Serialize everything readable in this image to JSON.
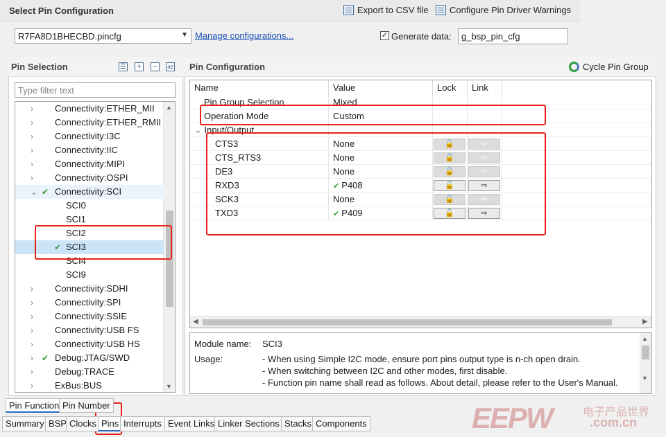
{
  "header": {
    "title": "Select Pin Configuration",
    "export_label": "Export to CSV file",
    "warnings_label": "Configure Pin Driver Warnings"
  },
  "config": {
    "selected_file": "R7FA8D1BHECBD.pincfg",
    "manage_link": "Manage configurations...",
    "generate_label": "Generate data:",
    "generate_checked": true,
    "generate_value": "g_bsp_pin_cfg"
  },
  "pin_selection": {
    "title": "Pin Selection",
    "filter_placeholder": "Type filter text",
    "items": [
      {
        "label": "Connectivity:ETHER_MII",
        "level": 0,
        "expanded": false,
        "check": false
      },
      {
        "label": "Connectivity:ETHER_RMII",
        "level": 0,
        "expanded": false,
        "check": false
      },
      {
        "label": "Connectivity:I3C",
        "level": 0,
        "expanded": false,
        "check": false
      },
      {
        "label": "Connectivity:IIC",
        "level": 0,
        "expanded": false,
        "check": false
      },
      {
        "label": "Connectivity:MIPI",
        "level": 0,
        "expanded": false,
        "check": false
      },
      {
        "label": "Connectivity:OSPI",
        "level": 0,
        "expanded": false,
        "check": false
      },
      {
        "label": "Connectivity:SCI",
        "level": 0,
        "expanded": true,
        "check": true
      },
      {
        "label": "SCI0",
        "level": 1,
        "check": false
      },
      {
        "label": "SCI1",
        "level": 1,
        "check": false
      },
      {
        "label": "SCI2",
        "level": 1,
        "check": false
      },
      {
        "label": "SCI3",
        "level": 1,
        "check": true,
        "selected": true
      },
      {
        "label": "SCI4",
        "level": 1,
        "check": false
      },
      {
        "label": "SCI9",
        "level": 1,
        "check": false
      },
      {
        "label": "Connectivity:SDHI",
        "level": 0,
        "expanded": false,
        "check": false
      },
      {
        "label": "Connectivity:SPI",
        "level": 0,
        "expanded": false,
        "check": false
      },
      {
        "label": "Connectivity:SSIE",
        "level": 0,
        "expanded": false,
        "check": false
      },
      {
        "label": "Connectivity:USB FS",
        "level": 0,
        "expanded": false,
        "check": false
      },
      {
        "label": "Connectivity:USB HS",
        "level": 0,
        "expanded": false,
        "check": false
      },
      {
        "label": "Debug:JTAG/SWD",
        "level": 0,
        "expanded": false,
        "check": true
      },
      {
        "label": "Debug:TRACE",
        "level": 0,
        "expanded": false,
        "check": false
      },
      {
        "label": "ExBus:BUS",
        "level": 0,
        "expanded": false,
        "check": false
      }
    ]
  },
  "pin_config": {
    "title": "Pin Configuration",
    "cycle_label": "Cycle Pin Group",
    "columns": [
      "Name",
      "Value",
      "Lock",
      "Link"
    ],
    "rows": [
      {
        "name": "Pin Group Selection",
        "value": "Mixed",
        "indent": 1,
        "buttons": false
      },
      {
        "name": "Operation Mode",
        "value": "Custom",
        "indent": 1,
        "buttons": false
      },
      {
        "name": "Input/Output",
        "value": "",
        "indent": 0,
        "group": true,
        "buttons": false
      },
      {
        "name": "CTS3",
        "value": "None",
        "indent": 2,
        "buttons": true,
        "active": false
      },
      {
        "name": "CTS_RTS3",
        "value": "None",
        "indent": 2,
        "buttons": true,
        "active": false
      },
      {
        "name": "DE3",
        "value": "None",
        "indent": 2,
        "buttons": true,
        "active": false
      },
      {
        "name": "RXD3",
        "value": "P408",
        "indent": 2,
        "buttons": true,
        "active": true,
        "check": true
      },
      {
        "name": "SCK3",
        "value": "None",
        "indent": 2,
        "buttons": true,
        "active": false
      },
      {
        "name": "TXD3",
        "value": "P409",
        "indent": 2,
        "buttons": true,
        "active": true,
        "check": true
      }
    ]
  },
  "module_info": {
    "module_label": "Module name:",
    "module_value": "SCI3",
    "usage_label": "Usage:",
    "usage_lines": [
      "- When using Simple I2C mode, ensure port pins output type is n-ch open drain.",
      "- When switching between I2C and other modes, first disable.",
      "- Function pin name shall read as follows. About detail, please refer to the User's Manual."
    ]
  },
  "sub_tabs": [
    "Pin Function",
    "Pin Number"
  ],
  "editor_tabs": [
    "Summary",
    "BSP",
    "Clocks",
    "Pins",
    "Interrupts",
    "Event Links",
    "Linker Sections",
    "Stacks",
    "Components"
  ],
  "active_editor_tab": "Pins",
  "watermark": {
    "logo": "EEPW",
    "chinese": "电子产品世界",
    "domain": ".com.cn"
  },
  "colors": {
    "highlight": "#e8221b",
    "check": "#3a9a3a",
    "selection": "#cce4f7",
    "link": "#1a4fb5"
  }
}
